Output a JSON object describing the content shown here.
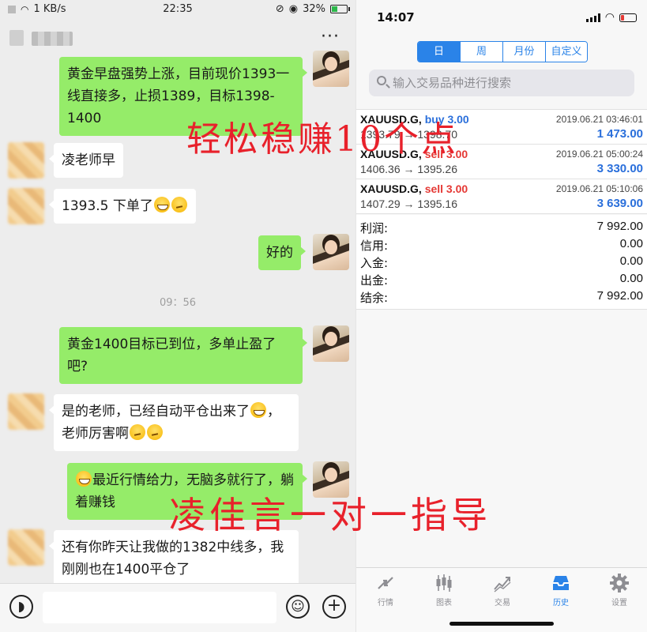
{
  "chat": {
    "status_bar": {
      "speed": "1 KB/s",
      "time": "22:35",
      "battery": "32%"
    },
    "input_bar": {
      "voice_icon": "voice-icon",
      "emoji_icon": "emoji-icon",
      "plus_icon": "plus-icon"
    },
    "messages": [
      {
        "from": "teacher",
        "text": "黄金早盘强势上涨，目前现价1393一线直接多，止损1389，目标1398-1400"
      },
      {
        "from": "student",
        "text": "凌老师早"
      },
      {
        "from": "student",
        "text": "1393.5 下单了"
      },
      {
        "from": "teacher",
        "text": "好的"
      },
      {
        "from": "teacher",
        "text": "黄金1400目标已到位，多单止盈了吧?"
      },
      {
        "from": "student",
        "text": "是的老师，已经自动平仓出来了"
      },
      {
        "from": "student",
        "text": "老师厉害啊"
      },
      {
        "from": "teacher",
        "text": "最近行情给力，无脑多就行了，躺着赚钱"
      },
      {
        "from": "student",
        "text": "还有你昨天让我做的1382中线多，我刚刚也在1400平仓了"
      }
    ],
    "time_label": "09：56"
  },
  "mt": {
    "status_bar": {
      "time": "14:07"
    },
    "periods": [
      "日",
      "周",
      "月份",
      "自定义"
    ],
    "active_period": "日",
    "search_placeholder": "输入交易品种进行搜索",
    "trades": [
      {
        "symbol": "XAUUSD.G,",
        "side": "buy 3.00",
        "datetime": "2019.06.21 03:46:01",
        "prices": "1393.79 → 1398.70",
        "profit": "1 473.00"
      },
      {
        "symbol": "XAUUSD.G,",
        "side": "sell 3.00",
        "datetime": "2019.06.21 05:00:24",
        "prices": "1406.36 → 1395.26",
        "profit": "3 330.00"
      },
      {
        "symbol": "XAUUSD.G,",
        "side": "sell 3.00",
        "datetime": "2019.06.21 05:10:06",
        "prices": "1407.29 → 1395.16",
        "profit": "3 639.00"
      }
    ],
    "summary": [
      {
        "label": "利润:",
        "value": "7 992.00"
      },
      {
        "label": "信用:",
        "value": "0.00"
      },
      {
        "label": "入金:",
        "value": "0.00"
      },
      {
        "label": "出金:",
        "value": "0.00"
      },
      {
        "label": "结余:",
        "value": "7 992.00"
      }
    ],
    "tabs": [
      {
        "label": "行情",
        "icon": "quotes-icon"
      },
      {
        "label": "图表",
        "icon": "chart-icon"
      },
      {
        "label": "交易",
        "icon": "trade-icon"
      },
      {
        "label": "历史",
        "icon": "history-icon"
      },
      {
        "label": "设置",
        "icon": "settings-icon"
      }
    ],
    "active_tab": "历史",
    "accent_color": "#2a83e8"
  },
  "watermarks": [
    "轻松稳赚10个点",
    "凌佳言一对一指导"
  ]
}
